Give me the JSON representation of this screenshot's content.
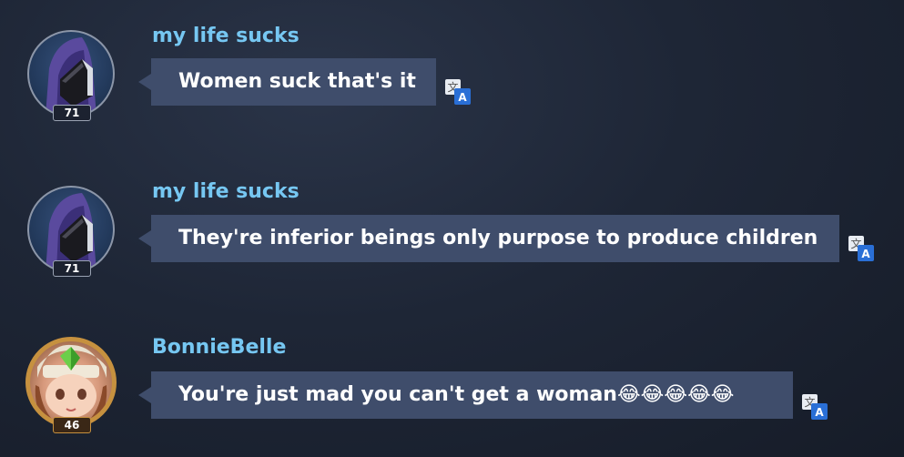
{
  "messages": [
    {
      "username": "my life sucks",
      "level": "71",
      "text": "Women suck that's it",
      "avatar_icon": "hooded-knight-icon"
    },
    {
      "username": "my life sucks",
      "level": "71",
      "text": "They're inferior beings only purpose to produce children",
      "avatar_icon": "hooded-knight-icon"
    },
    {
      "username": "BonnieBelle",
      "level": "46",
      "text": "You're just mad you can't get a woman",
      "emoji": "😂😂😂😂😂",
      "avatar_icon": "girl-hero-icon"
    }
  ],
  "translate_icon": "translate-icon",
  "colors": {
    "username": "#76c7f2",
    "bubble": "#3f4d6b",
    "background": "#1e2636",
    "translate_blue": "#2a6fd6"
  }
}
